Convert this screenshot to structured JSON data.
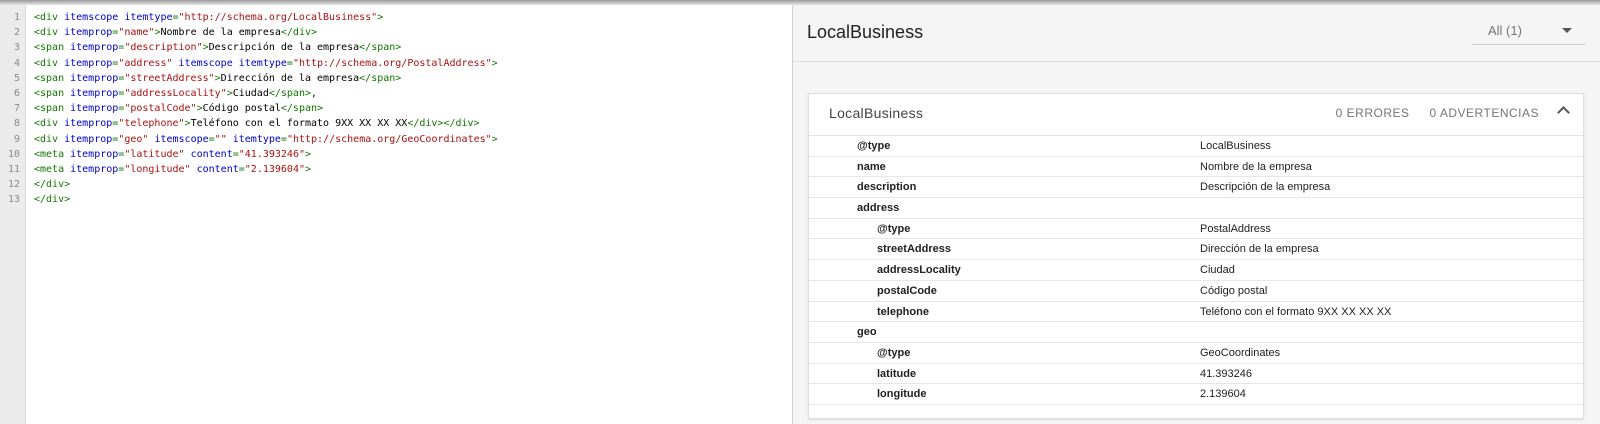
{
  "editor": {
    "lines": [
      [
        {
          "t": "tag",
          "v": "<div "
        },
        {
          "t": "attr",
          "v": "itemscope itemtype"
        },
        {
          "t": "tag",
          "v": "="
        },
        {
          "t": "str",
          "v": "\"http://schema.org/LocalBusiness\""
        },
        {
          "t": "tag",
          "v": ">"
        }
      ],
      [
        {
          "t": "tag",
          "v": "<div "
        },
        {
          "t": "attr",
          "v": "itemprop"
        },
        {
          "t": "tag",
          "v": "="
        },
        {
          "t": "str",
          "v": "\"name\""
        },
        {
          "t": "tag",
          "v": ">"
        },
        {
          "t": "text",
          "v": "Nombre de la empresa"
        },
        {
          "t": "tag",
          "v": "</div>"
        }
      ],
      [
        {
          "t": "tag",
          "v": "<span "
        },
        {
          "t": "attr",
          "v": "itemprop"
        },
        {
          "t": "tag",
          "v": "="
        },
        {
          "t": "str",
          "v": "\"description\""
        },
        {
          "t": "tag",
          "v": ">"
        },
        {
          "t": "text",
          "v": "Descripción de la empresa"
        },
        {
          "t": "tag",
          "v": "</span>"
        }
      ],
      [
        {
          "t": "tag",
          "v": "<div "
        },
        {
          "t": "attr",
          "v": "itemprop"
        },
        {
          "t": "tag",
          "v": "="
        },
        {
          "t": "str",
          "v": "\"address\""
        },
        {
          "t": "tag",
          "v": " "
        },
        {
          "t": "attr",
          "v": "itemscope itemtype"
        },
        {
          "t": "tag",
          "v": "="
        },
        {
          "t": "str",
          "v": "\"http://schema.org/PostalAddress\""
        },
        {
          "t": "tag",
          "v": ">"
        }
      ],
      [
        {
          "t": "tag",
          "v": "<span "
        },
        {
          "t": "attr",
          "v": "itemprop"
        },
        {
          "t": "tag",
          "v": "="
        },
        {
          "t": "str",
          "v": "\"streetAddress\""
        },
        {
          "t": "tag",
          "v": ">"
        },
        {
          "t": "text",
          "v": "Dirección de la empresa"
        },
        {
          "t": "tag",
          "v": "</span>"
        }
      ],
      [
        {
          "t": "tag",
          "v": "<span "
        },
        {
          "t": "attr",
          "v": "itemprop"
        },
        {
          "t": "tag",
          "v": "="
        },
        {
          "t": "str",
          "v": "\"addressLocality\""
        },
        {
          "t": "tag",
          "v": ">"
        },
        {
          "t": "text",
          "v": "Ciudad"
        },
        {
          "t": "tag",
          "v": "</span>"
        },
        {
          "t": "text",
          "v": ","
        }
      ],
      [
        {
          "t": "tag",
          "v": "<span "
        },
        {
          "t": "attr",
          "v": "itemprop"
        },
        {
          "t": "tag",
          "v": "="
        },
        {
          "t": "str",
          "v": "\"postalCode\""
        },
        {
          "t": "tag",
          "v": ">"
        },
        {
          "t": "text",
          "v": "Código postal"
        },
        {
          "t": "tag",
          "v": "</span>"
        }
      ],
      [
        {
          "t": "tag",
          "v": "<div "
        },
        {
          "t": "attr",
          "v": "itemprop"
        },
        {
          "t": "tag",
          "v": "="
        },
        {
          "t": "str",
          "v": "\"telephone\""
        },
        {
          "t": "tag",
          "v": ">"
        },
        {
          "t": "text",
          "v": "Teléfono con el formato 9XX XX XX XX"
        },
        {
          "t": "tag",
          "v": "</div></div>"
        }
      ],
      [
        {
          "t": "tag",
          "v": "<div "
        },
        {
          "t": "attr",
          "v": "itemprop"
        },
        {
          "t": "tag",
          "v": "="
        },
        {
          "t": "str",
          "v": "\"geo\""
        },
        {
          "t": "tag",
          "v": " "
        },
        {
          "t": "attr",
          "v": "itemscope"
        },
        {
          "t": "tag",
          "v": "="
        },
        {
          "t": "str",
          "v": "\"\""
        },
        {
          "t": "tag",
          "v": " "
        },
        {
          "t": "attr",
          "v": "itemtype"
        },
        {
          "t": "tag",
          "v": "="
        },
        {
          "t": "str",
          "v": "\"http://schema.org/GeoCoordinates\""
        },
        {
          "t": "tag",
          "v": ">"
        }
      ],
      [
        {
          "t": "tag",
          "v": "<meta "
        },
        {
          "t": "attr",
          "v": "itemprop"
        },
        {
          "t": "tag",
          "v": "="
        },
        {
          "t": "str",
          "v": "\"latitude\""
        },
        {
          "t": "tag",
          "v": " "
        },
        {
          "t": "attr",
          "v": "content"
        },
        {
          "t": "tag",
          "v": "="
        },
        {
          "t": "str",
          "v": "\"41.393246\""
        },
        {
          "t": "tag",
          "v": ">"
        }
      ],
      [
        {
          "t": "tag",
          "v": "<meta "
        },
        {
          "t": "attr",
          "v": "itemprop"
        },
        {
          "t": "tag",
          "v": "="
        },
        {
          "t": "str",
          "v": "\"longitude\""
        },
        {
          "t": "tag",
          "v": " "
        },
        {
          "t": "attr",
          "v": "content"
        },
        {
          "t": "tag",
          "v": "="
        },
        {
          "t": "str",
          "v": "\"2.139604\""
        },
        {
          "t": "tag",
          "v": ">"
        }
      ],
      [
        {
          "t": "tag",
          "v": "</div>"
        }
      ],
      [
        {
          "t": "tag",
          "v": "</div>"
        }
      ]
    ]
  },
  "panel": {
    "title": "LocalBusiness",
    "filter_label": "All (1)",
    "card": {
      "title": "LocalBusiness",
      "errors": "0 ERRORES",
      "warnings": "0 ADVERTENCIAS",
      "rows": [
        {
          "key": "@type",
          "value": "LocalBusiness",
          "level": 1
        },
        {
          "key": "name",
          "value": "Nombre de la empresa",
          "level": 1
        },
        {
          "key": "description",
          "value": "Descripción de la empresa",
          "level": 1
        },
        {
          "key": "address",
          "value": "",
          "level": 1
        },
        {
          "key": "@type",
          "value": "PostalAddress",
          "level": 2
        },
        {
          "key": "streetAddress",
          "value": "Dirección de la empresa",
          "level": 2
        },
        {
          "key": "addressLocality",
          "value": "Ciudad",
          "level": 2
        },
        {
          "key": "postalCode",
          "value": "Código postal",
          "level": 2
        },
        {
          "key": "telephone",
          "value": "Teléfono con el formato 9XX XX XX XX",
          "level": 2
        },
        {
          "key": "geo",
          "value": "",
          "level": 1
        },
        {
          "key": "@type",
          "value": "GeoCoordinates",
          "level": 2
        },
        {
          "key": "latitude",
          "value": "41.393246",
          "level": 2
        },
        {
          "key": "longitude",
          "value": "2.139604",
          "level": 2
        }
      ]
    }
  }
}
